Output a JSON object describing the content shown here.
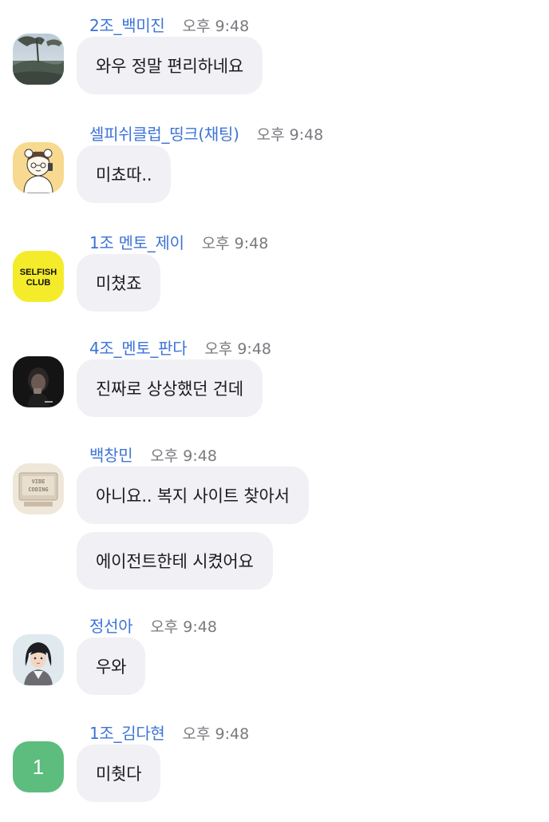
{
  "messages": [
    {
      "name": "2조_백미진",
      "time": "오후 9:48",
      "bubbles": [
        "와우 정말 편리하네요"
      ],
      "avatar": "landscape-photo"
    },
    {
      "name": "셀피쉬클럽_띵크(채팅)",
      "time": "오후 9:48",
      "bubbles": [
        "미쵸따.."
      ],
      "avatar": "cartoon-character"
    },
    {
      "name": "1조 멘토_제이",
      "time": "오후 9:48",
      "bubbles": [
        "미쳤죠"
      ],
      "avatar": "selfish-club-logo",
      "avatar_text": "SELFISH CLUB"
    },
    {
      "name": "4조_멘토_판다",
      "time": "오후 9:48",
      "bubbles": [
        "진짜로 상상했던 건데"
      ],
      "avatar": "dark-portrait-photo"
    },
    {
      "name": "백창민",
      "time": "오후 9:48",
      "bubbles": [
        "아니요.. 복지 사이트 찾아서",
        "에이전트한테 시켰어요"
      ],
      "avatar": "vibe-coding-logo",
      "avatar_text": "VIBE CODING"
    },
    {
      "name": "정선아",
      "time": "오후 9:48",
      "bubbles": [
        "우와"
      ],
      "avatar": "illustrated-portrait"
    },
    {
      "name": "1조_김다현",
      "time": "오후 9:48",
      "bubbles": [
        "미췃다"
      ],
      "avatar": "number-avatar",
      "avatar_text": "1"
    }
  ],
  "colors": {
    "name": "#3d73d6",
    "time": "#7a7a80",
    "bubble_bg": "#f0f0f5",
    "avatar_green": "#5cbd7e",
    "selfish_yellow": "#f4ec2a"
  }
}
